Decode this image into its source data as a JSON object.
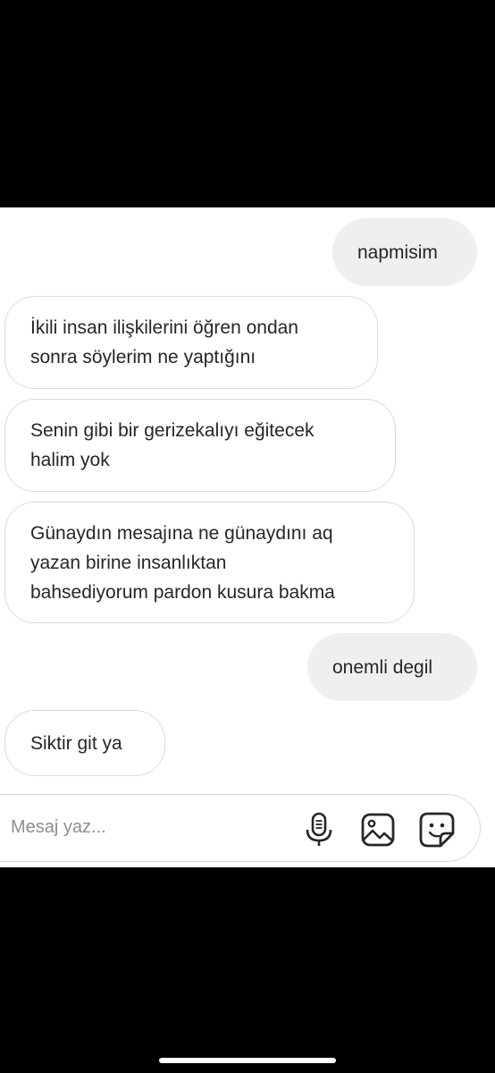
{
  "messages": [
    {
      "direction": "outgoing",
      "text": "napmisim"
    },
    {
      "direction": "incoming",
      "text": "İkili insan ilişkilerini öğren ondan\nsonra söylerim ne yaptığını"
    },
    {
      "direction": "incoming",
      "text": "Senin gibi bir gerizekalıyı eğitecek\nhalim yok"
    },
    {
      "direction": "incoming",
      "text": "Günaydın mesajına ne günaydını aq\nyazan birine insanlıktan\nbahsediyorum pardon kusura bakma"
    },
    {
      "direction": "outgoing",
      "text": "onemli degil"
    },
    {
      "direction": "incoming",
      "text": "Siktir git ya"
    }
  ],
  "composer": {
    "placeholder": "Mesaj yaz...",
    "icons": [
      "microphone-icon",
      "gallery-icon",
      "sticker-icon"
    ]
  },
  "colors": {
    "background": "#000000",
    "chat_background": "#ffffff",
    "outgoing_bubble": "#efefef",
    "incoming_border": "#dbdbdb",
    "text": "#262626",
    "placeholder": "#8e8e8e"
  }
}
